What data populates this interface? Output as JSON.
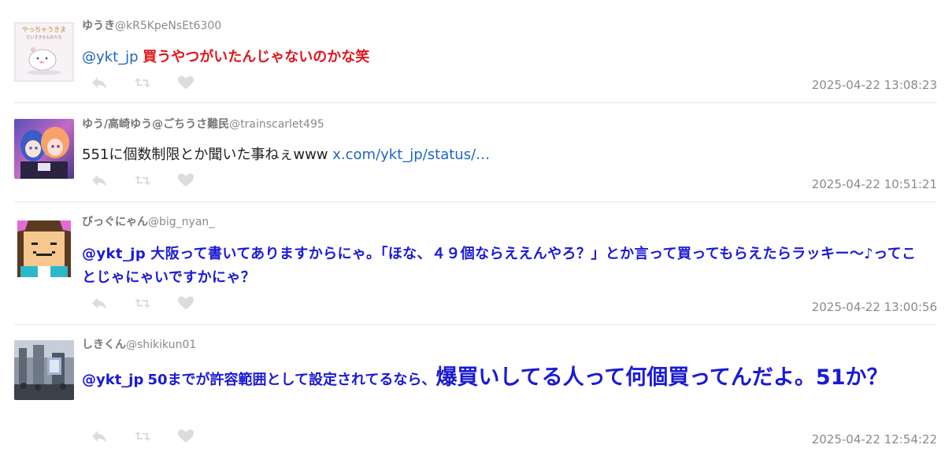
{
  "tweets": [
    {
      "display_name": "ゆうき",
      "screen_name": "@kR5KpeNsEt6300",
      "mention": "@ykt_jp",
      "text": "買うやつがいたんじゃないのかな笑",
      "timestamp": "2025-04-22 13:08:23"
    },
    {
      "display_name": "ゆう/高崎ゆう@ごちうさ難民",
      "screen_name": "@trainscarlet495",
      "text": "551に個数制限とか聞いた事ねぇwww ",
      "link": "x.com/ykt_jp/status/…",
      "timestamp": "2025-04-22 10:51:21"
    },
    {
      "display_name": "びっぐにゃん",
      "screen_name": "@big_nyan_",
      "mention": "@ykt_jp",
      "text": "大阪って書いてありますからにゃ。「ほな、４９個ならええんやろ？」とか言って買ってもらえたらラッキー～♪ってことじゃにゃいですかにゃ？",
      "timestamp": "2025-04-22 13:00:56"
    },
    {
      "display_name": "しきくん",
      "screen_name": "@shikikun01",
      "mention": "@ykt_jp",
      "text_small": "50までが許容範囲として設定されてるなら、",
      "text_large": "爆買いしてる人って何個買ってんだよ。51か？",
      "timestamp": "2025-04-22 12:54:22"
    }
  ],
  "icons": {
    "reply": "reply-icon",
    "retweet": "retweet-icon",
    "like": "heart-icon"
  },
  "colors": {
    "mention": "#1d66c2",
    "red_text": "#e0161c",
    "blue_text": "#1a1ad6",
    "meta": "#8a8a8a"
  }
}
